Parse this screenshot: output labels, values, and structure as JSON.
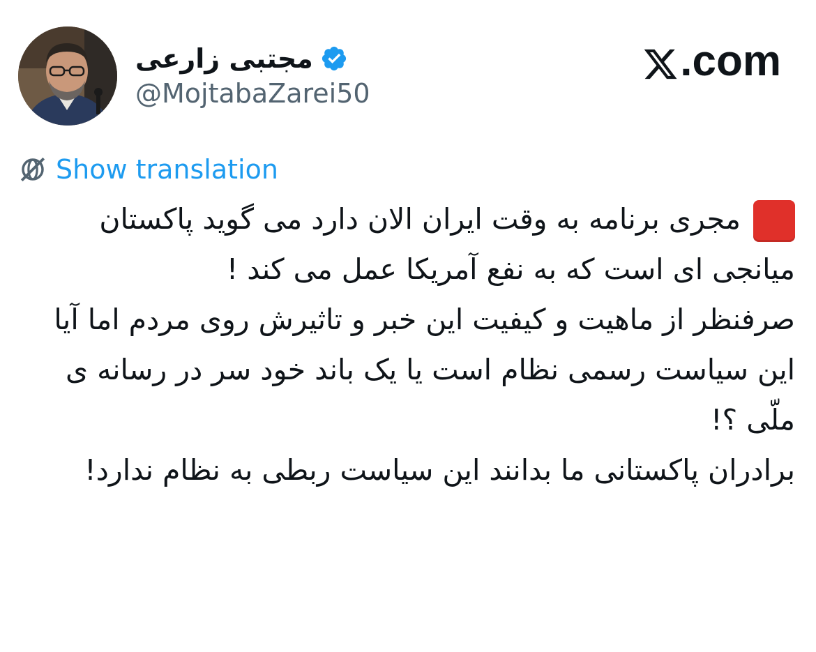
{
  "header": {
    "display_name": "مجتبی زارعی",
    "handle": "@MojtabaZarei50",
    "verified": true,
    "brand": ".com",
    "brand_icon": "x-logo-icon"
  },
  "translation": {
    "label": "Show translation",
    "icon": "globe-translate-icon"
  },
  "tweet": {
    "marker_icon": "red-square-emoji",
    "lines": [
      "مجری برنامه به وقت ایران الان دارد می گوید پاکستان میانجی ای است که به نفع آمریکا عمل می کند !",
      " صرفنظر از ماهیت و کیفیت  این خبر و تاثیرش روی مردم  اما آیا این سیاست رسمی نظام است یا یک باند خود سر در رسانه ی ملّی ؟!",
      "برادران پاکستانی ما بدانند این سیاست ربطی به نظام ندارد!"
    ]
  },
  "colors": {
    "link": "#1d9bf0",
    "verified": "#1d9bf0",
    "secondary_text": "#536471",
    "primary_text": "#0f1419",
    "marker": "#e0302a"
  }
}
